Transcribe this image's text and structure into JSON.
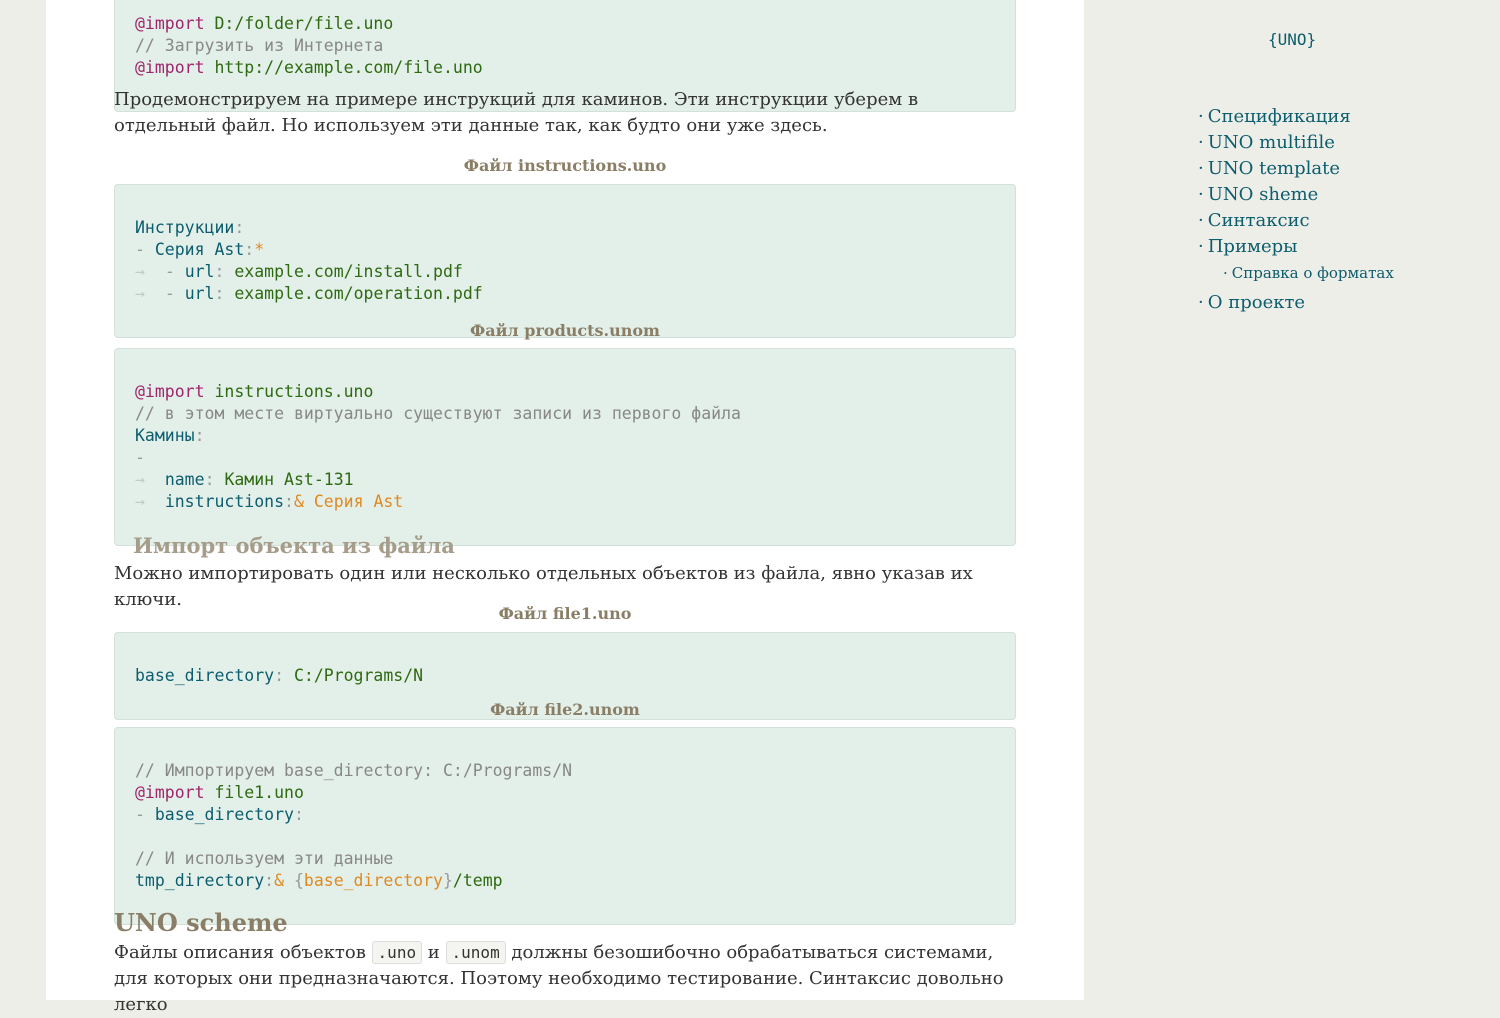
{
  "logo": "{UNO}",
  "toc": {
    "items": [
      {
        "label": "Спецификация"
      },
      {
        "label": "UNO multifile"
      },
      {
        "label": "UNO template"
      },
      {
        "label": "UNO sheme"
      },
      {
        "label": "Синтаксис"
      },
      {
        "label": "Примеры"
      }
    ],
    "sub_items": [
      {
        "label": "Справка о форматах"
      }
    ],
    "last_item": {
      "label": "О проекте"
    }
  },
  "top_code": {
    "line1_kw": "@import",
    "line1_val": " D:/folder/file.uno",
    "line2": "// Загрузить из Интернета",
    "line3_kw": "@import",
    "line3_val": " http://example.com/file.uno"
  },
  "para1": "Продемонстрируем на примере инструкций для каминов. Эти инструкции уберем в отдельный файл. Но используем эти данные так, как будто они уже здесь.",
  "caption1": "Файл instructions.uno",
  "code1": {
    "l1_key": "Инструкции",
    "l2_key": "Серия Ast",
    "l2_anchor": "*",
    "l3_key": "url",
    "l3_val": "example.com/install.pdf",
    "l4_key": "url",
    "l4_val": "example.com/operation.pdf"
  },
  "caption2": "Файл products.unom",
  "code2": {
    "l1_kw": "@import",
    "l1_val": " instructions.uno",
    "l2": "// в этом месте виртуально существуют записи из первого файла",
    "l3_key": "Камины",
    "l5_key": "name",
    "l5_val": "Камин Ast-131",
    "l6_key": "instructions",
    "l6_anchor": "& Серия Ast"
  },
  "heading_import": "Импорт объекта из файла",
  "para2": "Можно импортировать один или несколько отдельных объектов из файла, явно указав их ключи.",
  "caption3": "Файл file1.uno",
  "code3": {
    "l1_key": "base_directory",
    "l1_val": "C:/Programs/N"
  },
  "caption4": "Файл file2.unom",
  "code4": {
    "l1": "// Импортируем base_directory: C:/Programs/N",
    "l2_kw": "@import",
    "l2_val": " file1.uno",
    "l3_key": "base_directory",
    "l5": "// И используем эти данные",
    "l6_key": "tmp_directory",
    "l6_amp": "&",
    "l6_ref": "base_directory",
    "l6_tail": "/temp"
  },
  "heading_scheme": "UNO scheme",
  "para3": {
    "text1": "Файлы описания объектов ",
    "code1": ".uno",
    "text2": " и ",
    "code2": ".unom",
    "text3": " должны безошибочно обрабатываться системами, для которых они предназначаются. Поэтому необходимо тестирование. Синтаксис довольно легко"
  }
}
